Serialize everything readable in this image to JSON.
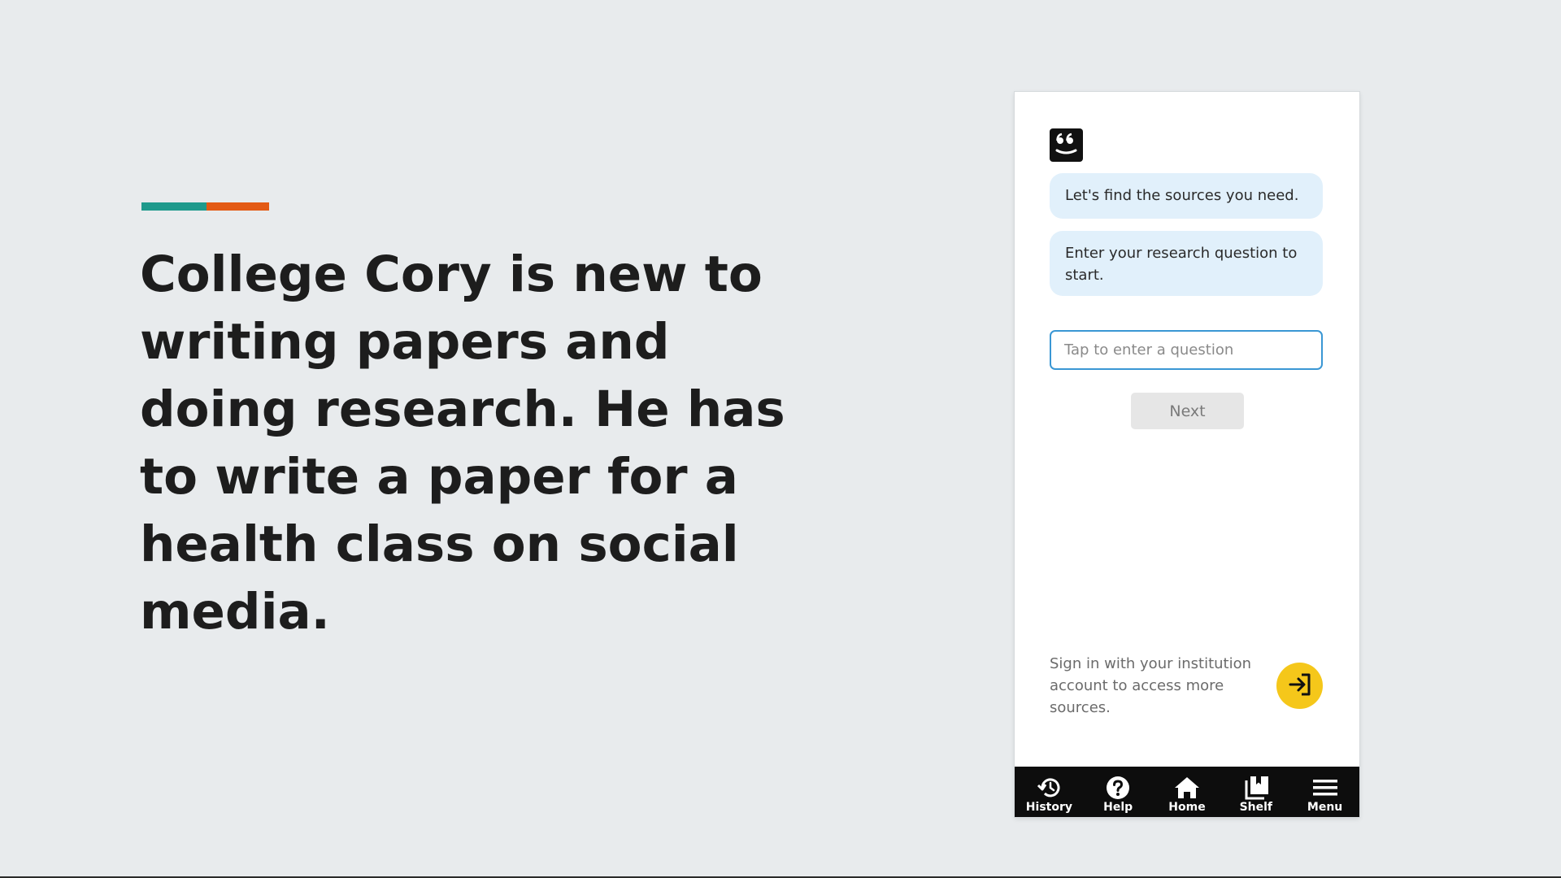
{
  "slide": {
    "headline": "College Cory is new to writing papers and doing research. He has to write a paper for a health class on social media.",
    "accent_colors": [
      "#1e9a8c",
      "#e35a14"
    ]
  },
  "app": {
    "logo_icon": "quote-face-icon",
    "messages": [
      {
        "text": "Let's find the sources you need."
      },
      {
        "text": "Enter your research question to start."
      }
    ],
    "question_input": {
      "value": "",
      "placeholder": "Tap to enter a question"
    },
    "next_label": "Next",
    "signin_text": "Sign in with your institution account to access more sources.",
    "signin_icon": "sign-in-icon",
    "signin_color": "#f5c71a",
    "nav": [
      {
        "label": "History",
        "icon": "history-icon"
      },
      {
        "label": "Help",
        "icon": "help-icon"
      },
      {
        "label": "Home",
        "icon": "home-icon"
      },
      {
        "label": "Shelf",
        "icon": "shelf-icon"
      },
      {
        "label": "Menu",
        "icon": "menu-icon"
      }
    ]
  }
}
